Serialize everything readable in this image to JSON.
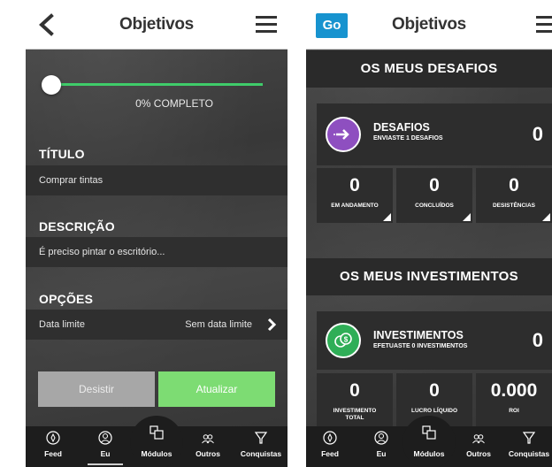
{
  "left_screen": {
    "header": {
      "title": "Objetivos"
    },
    "progress": {
      "value_percent": 0,
      "label": "0% COMPLETO"
    },
    "titulo": {
      "heading": "TÍTULO",
      "value": "Comprar tintas"
    },
    "descricao": {
      "heading": "DESCRIÇÃO",
      "value": "É preciso pintar o escritório..."
    },
    "opcoes": {
      "heading": "OPÇÕES",
      "label": "Data limite",
      "value": "Sem data limite"
    },
    "buttons": {
      "desistir": "Desistir",
      "atualizar": "Atualizar"
    },
    "nav": [
      {
        "label": "Feed",
        "icon": "compass-icon"
      },
      {
        "label": "Eu",
        "icon": "user-icon"
      },
      {
        "label": "Módulos",
        "icon": "modules-icon"
      },
      {
        "label": "Outros",
        "icon": "people-icon"
      },
      {
        "label": "Conquistas",
        "icon": "trophy-icon"
      }
    ]
  },
  "right_screen": {
    "header": {
      "logo": "Go",
      "title": "Objetivos"
    },
    "desafios_section": "OS MEUS DESAFIOS",
    "desafios_card": {
      "title": "DESAFIOS",
      "subtitle": "ENVIASTE 1 DESAFIOS",
      "value": "0"
    },
    "desafios_stats": [
      {
        "value": "0",
        "label": "EM ANDAMENTO"
      },
      {
        "value": "0",
        "label": "CONCLUÍDOS"
      },
      {
        "value": "0",
        "label": "DESISTÊNCIAS"
      }
    ],
    "investimentos_section": "OS MEUS INVESTIMENTOS",
    "investimentos_card": {
      "title": "INVESTIMENTOS",
      "subtitle": "EFETUASTE 0 INVESTIMENTOS",
      "value": "0"
    },
    "investimentos_stats": [
      {
        "value": "0",
        "label_line1": "INVESTIMENTO",
        "label_line2": "TOTAL"
      },
      {
        "value": "0",
        "label_line1": "LUCRO LÍQUIDO",
        "label_line2": ""
      },
      {
        "value": "0.000",
        "label_line1": "ROI",
        "label_line2": ""
      }
    ],
    "nav": [
      {
        "label": "Feed",
        "icon": "compass-icon"
      },
      {
        "label": "Eu",
        "icon": "user-icon"
      },
      {
        "label": "Módulos",
        "icon": "modules-icon"
      },
      {
        "label": "Outros",
        "icon": "people-icon"
      },
      {
        "label": "Conquistas",
        "icon": "trophy-icon"
      }
    ]
  },
  "colors": {
    "progress_green": "#3fcc6a",
    "button_gray": "#a7a7a7",
    "button_green": "#7ddc73",
    "desafios_purple": "#8e4fc0",
    "investimentos_green": "#2fae57",
    "logo_blue": "#1793cf"
  }
}
